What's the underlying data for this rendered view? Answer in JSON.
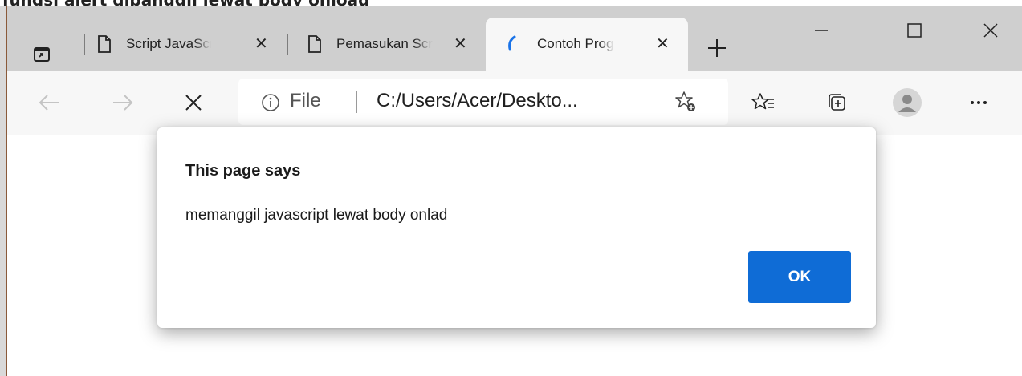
{
  "top_strip_text": "Tungsi alert dipanggil lewat body onload",
  "tabs": [
    {
      "label": "Script JavaScript",
      "icon": "page-icon",
      "active": false
    },
    {
      "label": "Pemasukan Script",
      "icon": "page-icon",
      "active": false
    },
    {
      "label": "Contoh Program",
      "icon": "loading-spinner-icon",
      "active": true
    }
  ],
  "address_bar": {
    "scheme_label": "File",
    "url": "C:/Users/Acer/Deskto..."
  },
  "dialog": {
    "title": "This page says",
    "message": "memanggil javascript lewat body onlad",
    "ok_label": "OK"
  },
  "colors": {
    "accent": "#0f6cd6",
    "tabstrip": "#cfcfcf",
    "toolbar": "#f7f7f7"
  }
}
